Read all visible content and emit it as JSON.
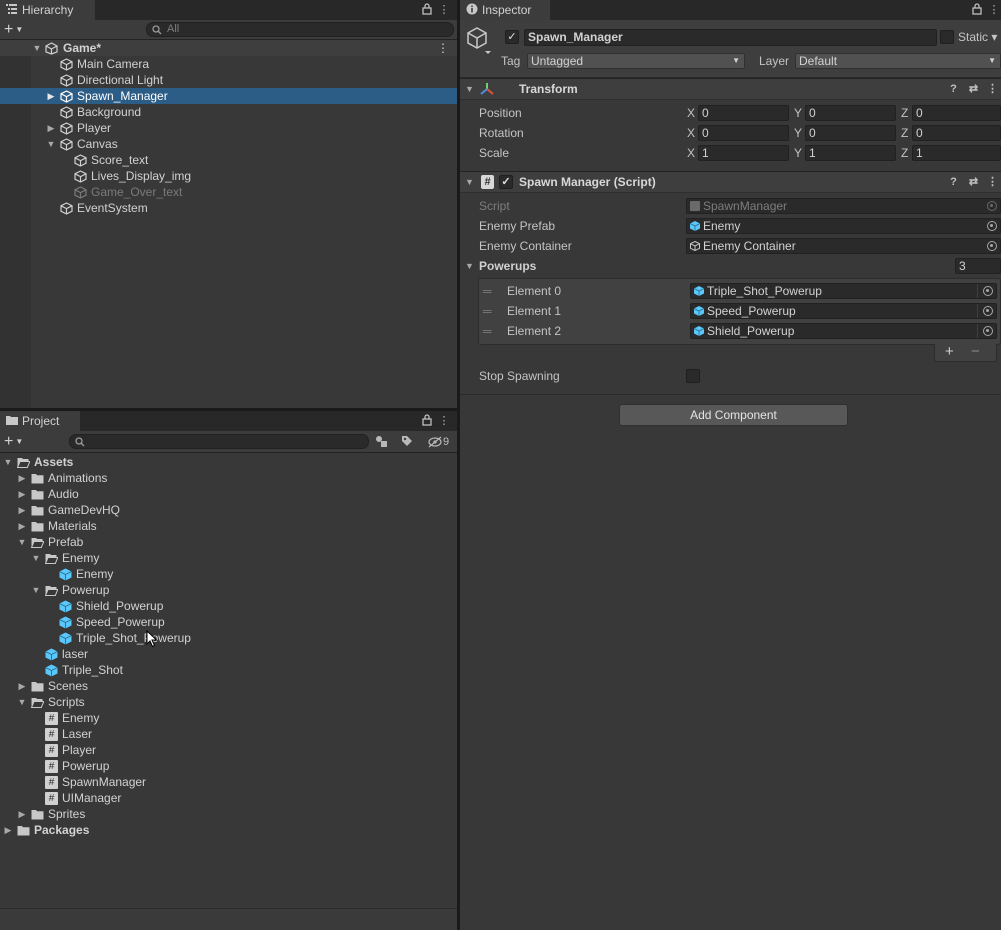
{
  "colors": {
    "selection": "#2c5d87",
    "panel": "#383838",
    "tabbar": "#282828",
    "prefab_blue": "#5ac8fa"
  },
  "hierarchy": {
    "tab_label": "Hierarchy",
    "search_placeholder": "All",
    "scene_name": "Game*",
    "items": [
      {
        "label": "Main Camera",
        "icon": "gameobject-icon"
      },
      {
        "label": "Directional Light",
        "icon": "gameobject-icon"
      },
      {
        "label": "Spawn_Manager",
        "icon": "gameobject-icon",
        "selected": true,
        "expandable": true
      },
      {
        "label": "Background",
        "icon": "gameobject-icon"
      },
      {
        "label": "Player",
        "icon": "gameobject-icon",
        "expandable": true
      },
      {
        "label": "Canvas",
        "icon": "gameobject-icon",
        "expanded": true
      },
      {
        "label": "Score_text",
        "icon": "gameobject-icon",
        "child": true
      },
      {
        "label": "Lives_Display_img",
        "icon": "gameobject-icon",
        "child": true
      },
      {
        "label": "Game_Over_text",
        "icon": "gameobject-icon",
        "child": true,
        "inactive": true
      },
      {
        "label": "EventSystem",
        "icon": "gameobject-icon"
      }
    ]
  },
  "project": {
    "tab_label": "Project",
    "hidden_count": "9",
    "tree": [
      {
        "label": "Assets",
        "type": "folder-open",
        "bold": true
      },
      {
        "label": "Animations",
        "type": "folder"
      },
      {
        "label": "Audio",
        "type": "folder"
      },
      {
        "label": "GameDevHQ",
        "type": "folder"
      },
      {
        "label": "Materials",
        "type": "folder"
      },
      {
        "label": "Prefab",
        "type": "folder-open"
      },
      {
        "label": "Enemy",
        "type": "folder-open"
      },
      {
        "label": "Enemy",
        "type": "prefab"
      },
      {
        "label": "Powerup",
        "type": "folder-open"
      },
      {
        "label": "Shield_Powerup",
        "type": "prefab"
      },
      {
        "label": "Speed_Powerup",
        "type": "prefab"
      },
      {
        "label": "Triple_Shot_Powerup",
        "type": "prefab"
      },
      {
        "label": "laser",
        "type": "prefab"
      },
      {
        "label": "Triple_Shot",
        "type": "prefab"
      },
      {
        "label": "Scenes",
        "type": "folder"
      },
      {
        "label": "Scripts",
        "type": "folder-open"
      },
      {
        "label": "Enemy",
        "type": "script"
      },
      {
        "label": "Laser",
        "type": "script"
      },
      {
        "label": "Player",
        "type": "script"
      },
      {
        "label": "Powerup",
        "type": "script"
      },
      {
        "label": "SpawnManager",
        "type": "script"
      },
      {
        "label": "UIManager",
        "type": "script"
      },
      {
        "label": "Sprites",
        "type": "folder"
      },
      {
        "label": "Packages",
        "type": "folder",
        "bold": true
      }
    ]
  },
  "inspector": {
    "tab_label": "Inspector",
    "object_name": "Spawn_Manager",
    "static_label": "Static",
    "tag_label": "Tag",
    "tag_value": "Untagged",
    "layer_label": "Layer",
    "layer_value": "Default",
    "transform": {
      "title": "Transform",
      "rows": [
        {
          "label": "Position",
          "x": "0",
          "y": "0",
          "z": "0"
        },
        {
          "label": "Rotation",
          "x": "0",
          "y": "0",
          "z": "0"
        },
        {
          "label": "Scale",
          "x": "1",
          "y": "1",
          "z": "1"
        }
      ]
    },
    "script_component": {
      "title": "Spawn Manager (Script)",
      "script_label": "Script",
      "script_value": "SpawnManager",
      "enemy_prefab_label": "Enemy Prefab",
      "enemy_prefab_value": "Enemy",
      "enemy_container_label": "Enemy Container",
      "enemy_container_value": "Enemy Container",
      "powerups_label": "Powerups",
      "powerups_count": "3",
      "elements": [
        {
          "label": "Element 0",
          "value": "Triple_Shot_Powerup"
        },
        {
          "label": "Element 1",
          "value": "Speed_Powerup"
        },
        {
          "label": "Element 2",
          "value": "Shield_Powerup"
        }
      ],
      "add_label": "+",
      "remove_label": "−",
      "stop_spawning_label": "Stop Spawning"
    },
    "add_component_label": "Add Component"
  }
}
